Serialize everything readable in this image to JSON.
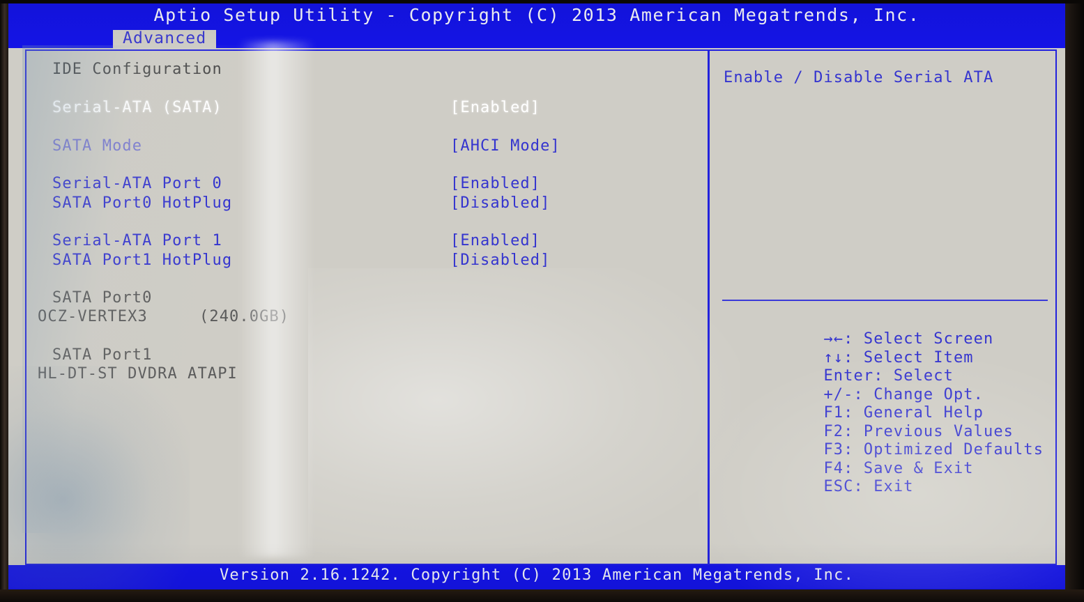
{
  "window": {
    "title": "Aptio Setup Utility - Copyright (C) 2013 American Megatrends, Inc.",
    "footer": "Version 2.16.1242. Copyright (C) 2013 American Megatrends, Inc."
  },
  "tabs": [
    {
      "label": "Advanced",
      "active": true
    }
  ],
  "main": {
    "section_title": "IDE Configuration",
    "rows": [
      {
        "label": "Serial-ATA (SATA)",
        "value": "[Enabled]",
        "style": "selected"
      },
      {
        "label": "SATA Mode",
        "value": "[AHCI Mode]",
        "style": "dimmed"
      },
      {
        "label": "Serial-ATA Port 0",
        "value": "[Enabled]",
        "style": "normal"
      },
      {
        "label": "SATA Port0 HotPlug",
        "value": "[Disabled]",
        "style": "normal"
      },
      {
        "label": "Serial-ATA Port 1",
        "value": "[Enabled]",
        "style": "normal"
      },
      {
        "label": "SATA Port1 HotPlug",
        "value": "[Disabled]",
        "style": "normal"
      }
    ],
    "devices": [
      {
        "port": "SATA Port0",
        "info": "OCZ-VERTEX3",
        "capacity": "(240.0GB)"
      },
      {
        "port": "SATA Port1",
        "info": "HL-DT-ST DVDRA ATAPI",
        "capacity": ""
      }
    ],
    "device_lines": {
      "port0_label": "SATA Port0",
      "port0_device": "OCZ-VERTEX3",
      "port0_capacity": "(240.0GB)",
      "port1_label": "SATA Port1",
      "port1_device": "HL-DT-ST DVDRA ATAPI"
    }
  },
  "help": {
    "text": "Enable / Disable Serial ATA",
    "legend": [
      {
        "key": "→←",
        "desc": ": Select Screen"
      },
      {
        "key": "↑↓",
        "desc": ": Select Item"
      },
      {
        "key": "Enter",
        "desc": ": Select"
      },
      {
        "key": "+/-",
        "desc": ": Change Opt."
      },
      {
        "key": "F1",
        "desc": ": General Help"
      },
      {
        "key": "F2",
        "desc": ": Previous Values"
      },
      {
        "key": "F3",
        "desc": ": Optimized Defaults"
      },
      {
        "key": "F4",
        "desc": ": Save & Exit"
      },
      {
        "key": "ESC",
        "desc": ": Exit"
      }
    ]
  },
  "colors": {
    "titlebar_blue": "#1414e6",
    "screen_gray": "#cfcdc6",
    "text_blue": "#3434cf",
    "text_dim_blue": "#7b7bcf",
    "text_selected": "#ffffff",
    "text_dark": "#5a5a5a",
    "border_blue": "#2222dd"
  }
}
